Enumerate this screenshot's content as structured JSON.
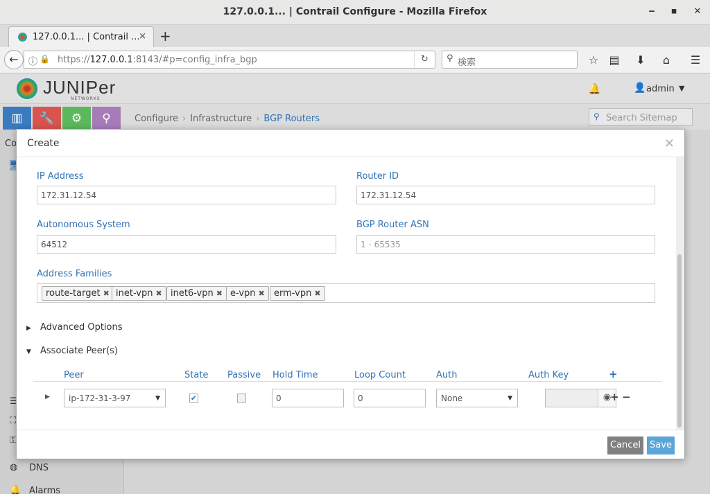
{
  "browser": {
    "window_title": "127.0.0.1... | Contrail Configure - Mozilla Firefox",
    "tab_label": "127.0.0.1... | Contrail ...",
    "tab_close": "×",
    "new_tab": "+",
    "url_prefix": "https://",
    "url_host": "127.0.0.1",
    "url_rest": ":8143/#p=config_infra_bgp",
    "search_placeholder": "検索",
    "window_buttons": {
      "minimize": "‒",
      "maximize": "◼",
      "close": "✕"
    }
  },
  "app": {
    "brand": "JUNIPer",
    "brand_sub": "NETWORKS",
    "user": "admin",
    "breadcrumb": [
      "Configure",
      "Infrastructure",
      "BGP Routers"
    ],
    "sitemap_placeholder": "Search Sitemap",
    "module_colors": [
      "#3a7bbf",
      "#d9534f",
      "#5cb85c",
      "#a77bb8"
    ],
    "left_menu": [
      {
        "icon": "list-icon",
        "label": ""
      },
      {
        "icon": "sitemap-icon",
        "label": ""
      },
      {
        "icon": "key-icon",
        "label": ""
      },
      {
        "icon": "globe-icon",
        "label": "DNS"
      },
      {
        "icon": "bell-icon",
        "label": "Alarms"
      }
    ],
    "hidden_tab_text": "Co"
  },
  "modal": {
    "title": "Create",
    "close": "×",
    "fields": {
      "ip_address": {
        "label": "IP Address",
        "value": "172.31.12.54"
      },
      "router_id": {
        "label": "Router ID",
        "value": "172.31.12.54"
      },
      "asn": {
        "label": "Autonomous System",
        "value": "64512"
      },
      "bgp_asn": {
        "label": "BGP Router ASN",
        "placeholder": "1 - 65535"
      }
    },
    "address_families": {
      "label": "Address Families",
      "tags": [
        "route-target",
        "inet-vpn",
        "inet6-vpn",
        "e-vpn",
        "erm-vpn"
      ],
      "remove_glyph": "✖"
    },
    "advanced_options": "Advanced Options",
    "associate_peers": "Associate Peer(s)",
    "peer_grid": {
      "columns": [
        "Peer",
        "State",
        "Passive",
        "Hold Time",
        "Loop Count",
        "Auth",
        "Auth Key"
      ],
      "add": "+",
      "rows": [
        {
          "peer": "ip-172-31-3-97",
          "state": true,
          "passive": false,
          "hold_time": "0",
          "loop_count": "0",
          "auth": "None",
          "auth_key": ""
        }
      ],
      "row_add": "+",
      "row_remove": "−"
    },
    "buttons": {
      "cancel": "Cancel",
      "save": "Save"
    }
  }
}
